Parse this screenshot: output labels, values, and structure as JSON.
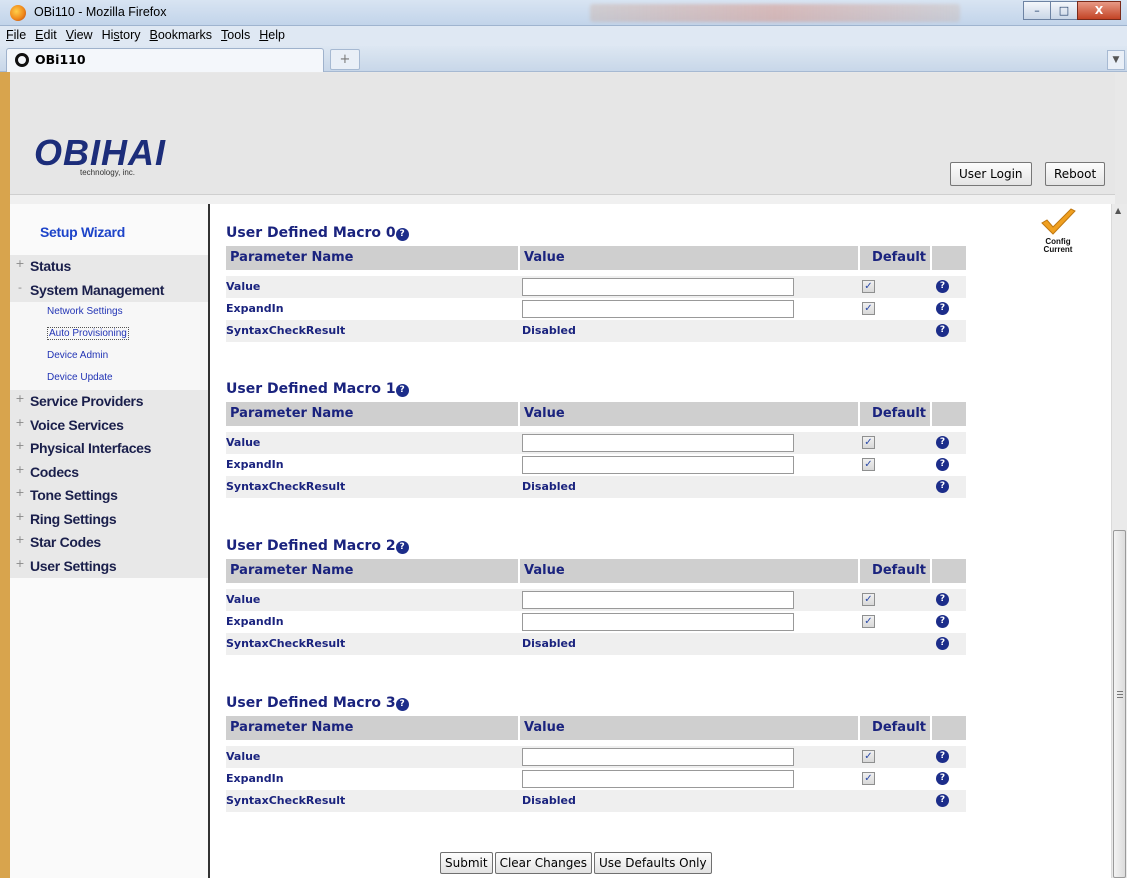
{
  "window": {
    "title": "OBi110 - Mozilla Firefox",
    "buttons": {
      "minimize": "–",
      "maximize": "□",
      "close": "X"
    }
  },
  "menubar": {
    "items": [
      {
        "pre": "",
        "u": "F",
        "post": "ile"
      },
      {
        "pre": "",
        "u": "E",
        "post": "dit"
      },
      {
        "pre": "",
        "u": "V",
        "post": "iew"
      },
      {
        "pre": "Hi",
        "u": "s",
        "post": "tory"
      },
      {
        "pre": "",
        "u": "B",
        "post": "ookmarks"
      },
      {
        "pre": "",
        "u": "T",
        "post": "ools"
      },
      {
        "pre": "",
        "u": "H",
        "post": "elp"
      }
    ]
  },
  "tabs": {
    "active_label": "OBi110",
    "new_tab": "+",
    "menu": "▼"
  },
  "header": {
    "logo": "OBIHAI",
    "logo_sub": "technology, inc.",
    "user_login": "User Login",
    "reboot": "Reboot"
  },
  "sidebar": {
    "wizard": "Setup Wizard",
    "items": [
      {
        "sign": "+",
        "label": "Status"
      },
      {
        "sign": "-",
        "label": "System Management"
      },
      {
        "sign": "+",
        "label": "Service Providers"
      },
      {
        "sign": "+",
        "label": "Voice Services"
      },
      {
        "sign": "+",
        "label": "Physical Interfaces"
      },
      {
        "sign": "+",
        "label": "Codecs"
      },
      {
        "sign": "+",
        "label": "Tone Settings"
      },
      {
        "sign": "+",
        "label": "Ring Settings"
      },
      {
        "sign": "+",
        "label": "Star Codes"
      },
      {
        "sign": "+",
        "label": "User Settings"
      }
    ],
    "sub_items": [
      "Network Settings",
      "Auto Provisioning",
      "Device Admin",
      "Device Update"
    ],
    "active_sub": "Auto Provisioning"
  },
  "badge": {
    "line1": "Config",
    "line2": "Current"
  },
  "table_headers": {
    "param": "Parameter Name",
    "value": "Value",
    "default": "Default"
  },
  "macros": [
    {
      "title": "User Defined Macro 0",
      "rows": [
        {
          "name": "Value",
          "value": "",
          "default_checked": true
        },
        {
          "name": "ExpandIn",
          "value": "",
          "default_checked": true
        },
        {
          "name": "SyntaxCheckResult",
          "static": "Disabled"
        }
      ]
    },
    {
      "title": "User Defined Macro 1",
      "rows": [
        {
          "name": "Value",
          "value": "",
          "default_checked": true
        },
        {
          "name": "ExpandIn",
          "value": "",
          "default_checked": true
        },
        {
          "name": "SyntaxCheckResult",
          "static": "Disabled"
        }
      ]
    },
    {
      "title": "User Defined Macro 2",
      "rows": [
        {
          "name": "Value",
          "value": "",
          "default_checked": true
        },
        {
          "name": "ExpandIn",
          "value": "",
          "default_checked": true
        },
        {
          "name": "SyntaxCheckResult",
          "static": "Disabled"
        }
      ]
    },
    {
      "title": "User Defined Macro 3",
      "rows": [
        {
          "name": "Value",
          "value": "",
          "default_checked": true
        },
        {
          "name": "ExpandIn",
          "value": "",
          "default_checked": true
        },
        {
          "name": "SyntaxCheckResult",
          "static": "Disabled"
        }
      ]
    }
  ],
  "actions": {
    "submit": "Submit",
    "clear": "Clear Changes",
    "defaults": "Use Defaults Only"
  },
  "help_glyph": "?",
  "check_glyph": "✓",
  "colors": {
    "accent": "#1a237e",
    "link": "#1d44c9",
    "badge_orange": "#f0a020"
  }
}
